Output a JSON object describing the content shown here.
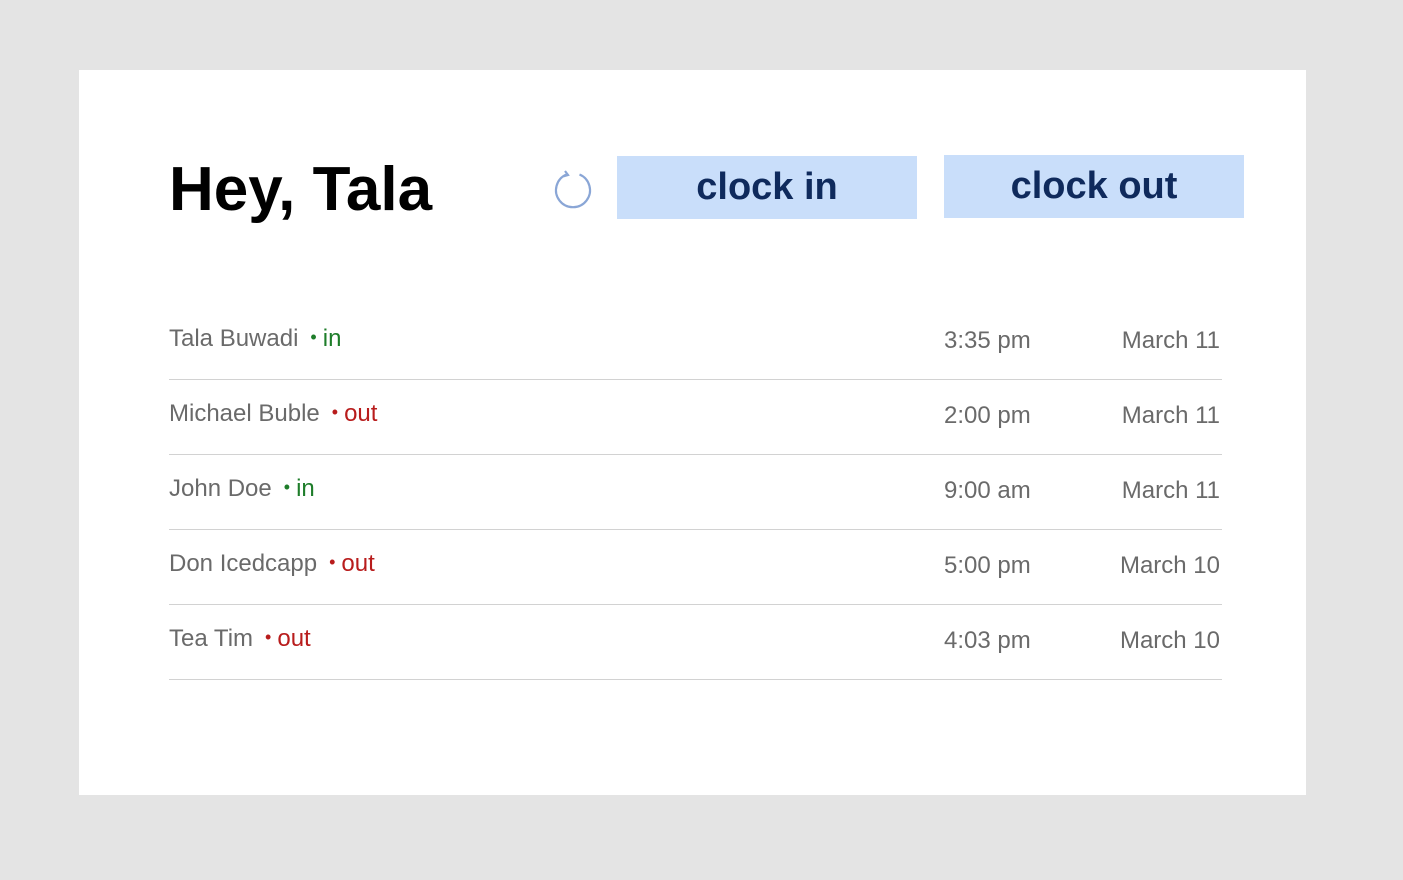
{
  "header": {
    "greeting": "Hey, Tala",
    "refresh_icon": "refresh-icon",
    "clock_in_label": "clock in",
    "clock_out_label": "clock out"
  },
  "colors": {
    "page_bg": "#e4e4e4",
    "card_bg": "#ffffff",
    "button_bg": "#c9defa",
    "button_text": "#0f2a5c",
    "status_in": "#1e7d2a",
    "status_out": "#b81c1c",
    "refresh_icon": "#8aa6d6"
  },
  "entries": [
    {
      "name": "Tala Buwadi",
      "dot": "•",
      "status": "in",
      "time": "3:35 pm",
      "date": "March 11"
    },
    {
      "name": "Michael Buble",
      "dot": "•",
      "status": "out",
      "time": "2:00 pm",
      "date": "March 11"
    },
    {
      "name": "John Doe",
      "dot": "•",
      "status": "in",
      "time": "9:00 am",
      "date": "March 11"
    },
    {
      "name": "Don Icedcapp",
      "dot": "•",
      "status": "out",
      "time": "5:00 pm",
      "date": "March 10"
    },
    {
      "name": "Tea Tim",
      "dot": "•",
      "status": "out",
      "time": "4:03 pm",
      "date": "March 10"
    }
  ]
}
